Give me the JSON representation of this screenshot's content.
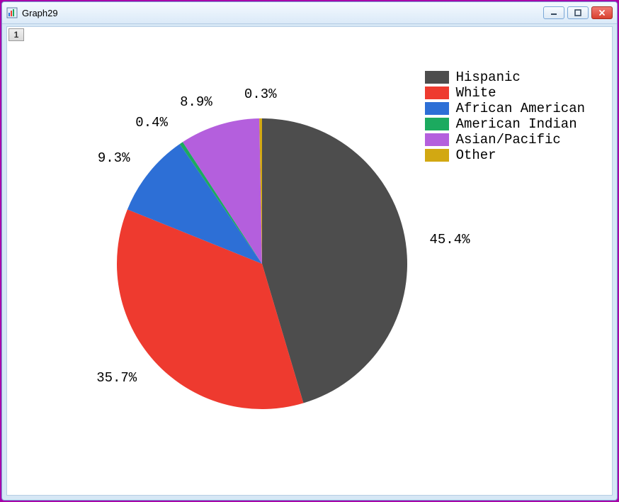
{
  "window": {
    "title": "Graph29",
    "tab_label": "1"
  },
  "win_controls": {
    "minimize_aria": "Minimize",
    "maximize_aria": "Maximize",
    "close_aria": "Close"
  },
  "chart_data": {
    "type": "pie",
    "title": "",
    "series": [
      {
        "name": "Hispanic",
        "value": 45.4,
        "label": "45.4%",
        "color": "#4d4d4d"
      },
      {
        "name": "White",
        "value": 35.7,
        "label": "35.7%",
        "color": "#ee3a2f"
      },
      {
        "name": "African American",
        "value": 9.3,
        "label": "9.3%",
        "color": "#2d6fd6"
      },
      {
        "name": "American Indian",
        "value": 0.4,
        "label": "0.4%",
        "color": "#1caa5f"
      },
      {
        "name": "Asian/Pacific",
        "value": 8.9,
        "label": "8.9%",
        "color": "#b45fdd"
      },
      {
        "name": "Other",
        "value": 0.3,
        "label": "0.3%",
        "color": "#d2a812"
      }
    ],
    "legend_position": "top-right",
    "start_angle": 90,
    "direction": "clockwise"
  }
}
